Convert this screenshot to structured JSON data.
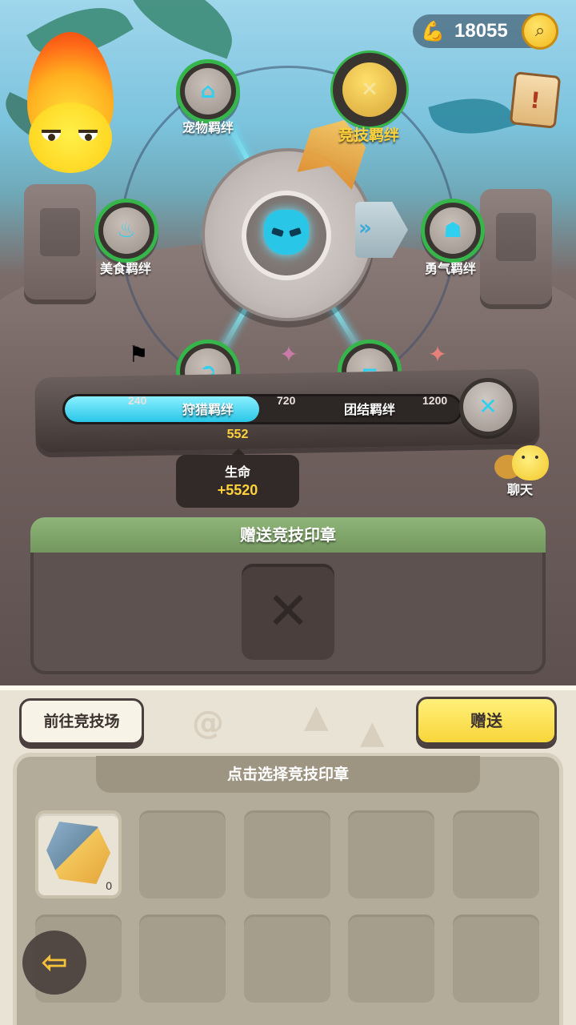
{
  "currency": {
    "icon": "arm-muscle-icon",
    "value": "18055"
  },
  "wheel": {
    "nodes": [
      {
        "label": "宠物羁绊",
        "icon": "pet-icon",
        "glyph": "⌂",
        "active": false
      },
      {
        "label": "竞技羁绊",
        "icon": "arena-swords-icon",
        "glyph": "✕",
        "active": true
      },
      {
        "label": "美食羁绊",
        "icon": "food-icon",
        "glyph": "♨",
        "active": false
      },
      {
        "label": "勇气羁绊",
        "icon": "courage-icon",
        "glyph": "☗",
        "active": false
      },
      {
        "label": "狩猎羁绊",
        "icon": "hunt-icon",
        "glyph": "➲",
        "active": false
      },
      {
        "label": "团结羁绊",
        "icon": "unity-icon",
        "glyph": "⌐",
        "active": false
      }
    ],
    "beam_color": "#7ff0ff",
    "ring_color": "#36b64a"
  },
  "progress": {
    "current": "552",
    "max": 1200,
    "milestones": [
      "240",
      "720",
      "1200"
    ],
    "fill_color": "#29c6e8",
    "reward_tooltip": {
      "stat": "生命",
      "bonus": "+5520"
    }
  },
  "chat": {
    "label": "聊天"
  },
  "gift_panel": {
    "title": "赠送竞技印章",
    "slot_icon": "arena-seal-placeholder-icon"
  },
  "actions": {
    "goto_label": "前往竞技场",
    "gift_label": "赠送"
  },
  "inventory": {
    "header": "点击选择竞技印章",
    "items": [
      {
        "icon": "arena-seal-stone-icon",
        "count": "0"
      }
    ]
  },
  "icons": {
    "search": "search-icon",
    "quest": "quest-scroll-icon",
    "back": "back-arrow-icon"
  }
}
